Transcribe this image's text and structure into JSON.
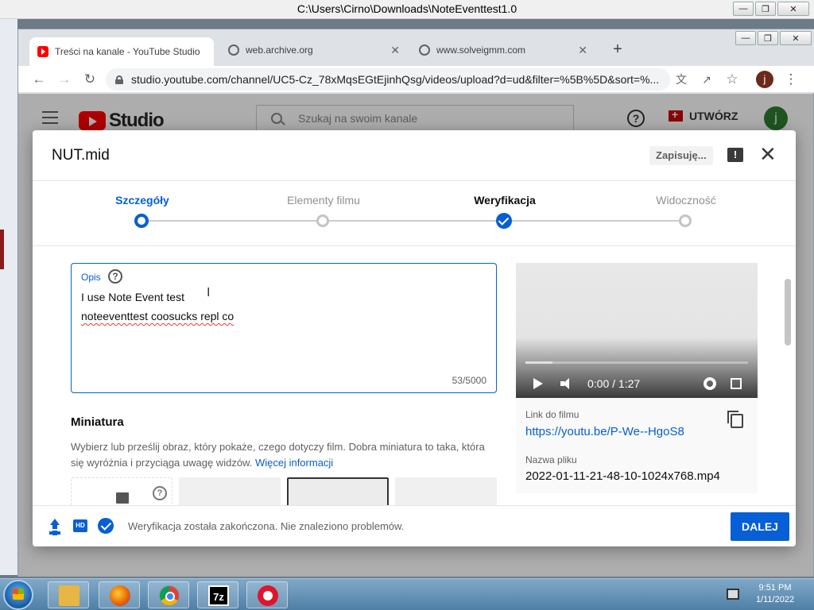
{
  "outer_window": {
    "title": "C:\\Users\\Cirno\\Downloads\\NoteEventtest1.0"
  },
  "browser": {
    "tabs": [
      {
        "label": "Treści na kanale - YouTube Studio"
      },
      {
        "label": "web.archive.org"
      },
      {
        "label": "www.solveigmm.com"
      }
    ],
    "url": "studio.youtube.com/channel/UC5-Cz_78xMqsEGtEjinhQsg/videos/upload?d=ud&filter=%5B%5D&sort=%...",
    "profile_initial": "j"
  },
  "studio": {
    "logo_text": "Studio",
    "search_placeholder": "Szukaj na swoim kanale",
    "create_label": "UTWÓRZ",
    "avatar_initial": "j"
  },
  "dialog": {
    "title": "NUT.mid",
    "saving_label": "Zapisuję...",
    "steps": [
      {
        "label": "Szczegóły",
        "state": "current"
      },
      {
        "label": "Elementy filmu",
        "state": "pending"
      },
      {
        "label": "Weryfikacja",
        "state": "done"
      },
      {
        "label": "Widoczność",
        "state": "pending"
      }
    ],
    "description": {
      "label": "Opis",
      "line1": "I use Note Event test",
      "line2": "noteeventtest coosucks repl co",
      "char_count": "53/5000"
    },
    "thumbnail": {
      "title": "Miniatura",
      "description": "Wybierz lub prześlij obraz, który pokaże, czego dotyczy film. Dobra miniatura to taka, która się wyróżnia i przyciąga uwagę widzów.",
      "more_link": "Więcej informacji"
    },
    "video": {
      "time": "0:00 / 1:27",
      "progress": 0.12,
      "link_label": "Link do filmu",
      "link": "https://youtu.be/P-We--HgoS8",
      "file_label": "Nazwa pliku",
      "file_name": "2022-01-11-21-48-10-1024x768.mp4"
    },
    "footer": {
      "status": "Weryfikacja została zakończona. Nie znaleziono problemów.",
      "next_label": "DALEJ",
      "hd_badge": "HD"
    },
    "accent_color": "#065fd4"
  },
  "taskbar": {
    "time": "9:51 PM",
    "date": "1/11/2022",
    "sevenzip_label": "7z"
  }
}
